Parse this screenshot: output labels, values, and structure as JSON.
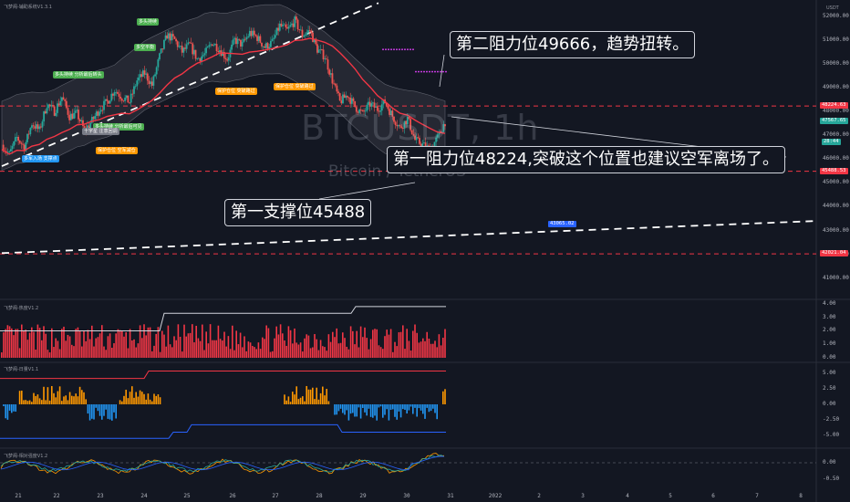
{
  "indicator_title": "飞梦阁-辅助系统V1.3.1",
  "currency": "USDT",
  "watermark": {
    "symbol": "BTCUSDT, 1h",
    "name": "Bitcoin / TetherUS"
  },
  "annotations": {
    "resistance2": "第二阻力位49666，趋势扭转。",
    "resistance1": "第一阻力位48224,突破这个位置也建议空军离场了。",
    "support1": "第一支撑位45488"
  },
  "colors": {
    "bg": "#131722",
    "up": "#26a69a",
    "down": "#ef5350",
    "level": "#f23645",
    "trend": "#ffffff",
    "ma": "#f23645",
    "heat": "#f23645",
    "bull": "#ff9800",
    "bear": "#2196f3"
  },
  "signals": [
    {
      "text": "多头持续",
      "color": "#4caf50"
    },
    {
      "text": "多头持续\n分析最后转头",
      "color": "#4caf50"
    },
    {
      "text": "多空平衡",
      "color": "#4caf50"
    },
    {
      "text": "多头持续\n分析最后可见",
      "color": "#4caf50"
    },
    {
      "text": "保护仓位\n突破路过",
      "color": "#ff9800"
    },
    {
      "text": "保护仓位\n突破路过",
      "color": "#ff9800"
    },
    {
      "text": "保护仓位\n空军减仓",
      "color": "#ff9800"
    },
    {
      "text": "十字星\n注意回调",
      "color": "#787b86"
    },
    {
      "text": "多军入场\n支撑点",
      "color": "#2196f3"
    }
  ],
  "chart_data": [
    {
      "type": "candlestick",
      "title": "BTCUSDT, 1h",
      "yaxis_ticks": [
        41000,
        42000,
        43000,
        44000,
        45000,
        46000,
        47000,
        48000,
        49000,
        50000,
        51000,
        52000
      ],
      "ylim": [
        40300,
        52600
      ],
      "xaxis_ticks": [
        "21",
        "22",
        "23",
        "24",
        "25",
        "26",
        "27",
        "28",
        "29",
        "30",
        "31",
        "2022",
        "2",
        "3",
        "4",
        "5",
        "6",
        "7",
        "8"
      ],
      "horizontal_levels": [
        48224.63,
        45488.53,
        42021.04
      ],
      "price_labels": [
        {
          "value": "48224.63",
          "color": "#f23645"
        },
        {
          "value": "47567.65",
          "color": "#26a69a"
        },
        {
          "value": "45488.53",
          "color": "#f23645"
        },
        {
          "value": "42021.04",
          "color": "#f23645"
        }
      ],
      "price_sub": "28:44",
      "trendline_label": "43065.02",
      "close_series": [
        46600,
        46200,
        46900,
        46500,
        47500,
        47200,
        48300,
        48000,
        48600,
        47800,
        47900,
        47200,
        47600,
        48100,
        48400,
        48900,
        48600,
        48400,
        49300,
        49600,
        49100,
        50300,
        51200,
        51000,
        50500,
        50800,
        50200,
        50400,
        50900,
        50600,
        50200,
        51000,
        50800,
        51300,
        51100,
        50700,
        50900,
        51600,
        51400,
        51800,
        51200,
        51400,
        50600,
        50300,
        49300,
        48400,
        48700,
        48200,
        47900,
        48300,
        48100,
        48400,
        47800,
        47300,
        47700,
        46800,
        46600,
        46400,
        46900,
        47567
      ]
    },
    {
      "type": "bar",
      "title": "飞梦阁-热度V1.2",
      "yaxis_ticks": [
        "4.00",
        "3.00",
        "2.00",
        "1.00",
        "0.00"
      ],
      "ylim": [
        0,
        4.2
      ]
    },
    {
      "type": "bar",
      "title": "飞梦阁-日量V1.1",
      "yaxis_ticks": [
        "5.00",
        "2.50",
        "0.00",
        "-2.50",
        "-5.00"
      ],
      "ylim": [
        -6.5,
        6.5
      ]
    },
    {
      "type": "line",
      "title": "飞梦阁-相对强度V1.2",
      "yaxis_ticks": [
        "0.00",
        "-0.50"
      ],
      "ylim": [
        -0.8,
        0.4
      ]
    }
  ]
}
